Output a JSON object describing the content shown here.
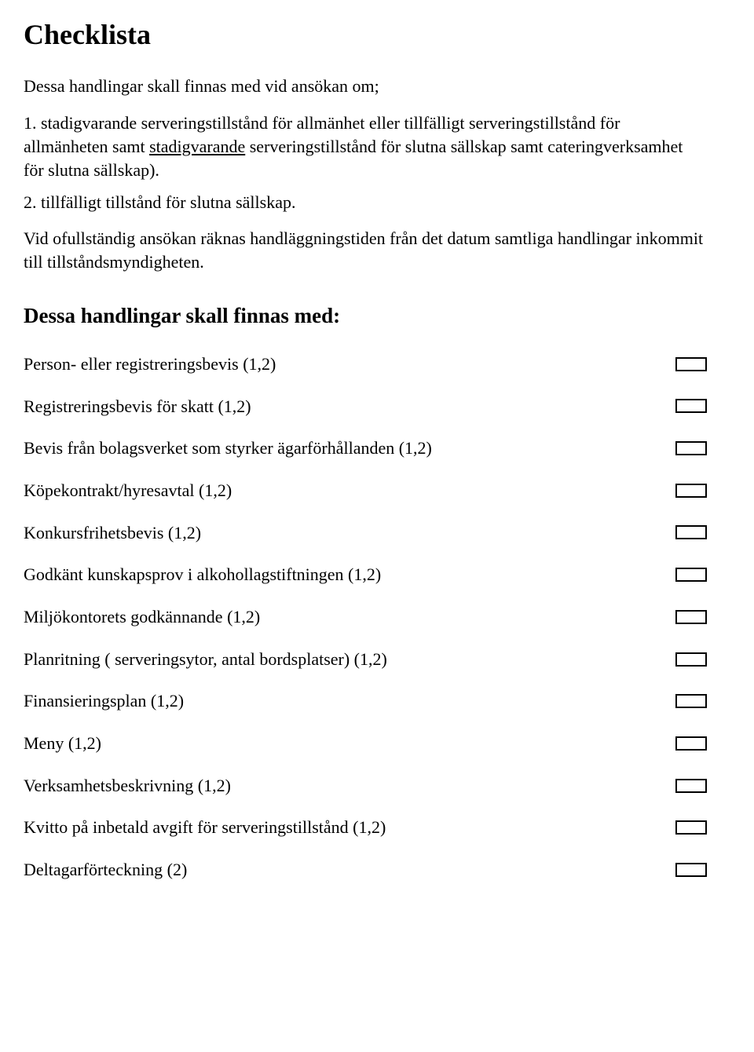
{
  "title": "Checklista",
  "intro": "Dessa handlingar skall finnas med vid ansökan om;",
  "item1_pre": "1. stadigvarande serveringstillstånd för allmänhet eller tillfälligt serveringstillstånd för allmänheten samt ",
  "item1_underline": "stadigvarande",
  "item1_post": " serveringstillstånd för slutna sällskap samt cateringverksamhet för slutna sällskap).",
  "item2": "2. tillfälligt tillstånd för slutna sällskap.",
  "note": "Vid ofullständig ansökan räknas handläggningstiden från det datum samtliga handlingar inkommit till tillståndsmyndigheten.",
  "subtitle": "Dessa handlingar skall finnas med:",
  "checks": [
    {
      "label": "Person- eller registreringsbevis (1,2)"
    },
    {
      "label": "Registreringsbevis för skatt (1,2)"
    },
    {
      "label": "Bevis från bolagsverket som styrker ägarförhållanden (1,2)"
    },
    {
      "label": "Köpekontrakt/hyresavtal (1,2)"
    },
    {
      "label": "Konkursfrihetsbevis (1,2)"
    },
    {
      "label": "Godkänt kunskapsprov i alkohollagstiftningen (1,2)"
    },
    {
      "label": "Miljökontorets godkännande (1,2)"
    },
    {
      "label": "Planritning ( serveringsytor, antal bordsplatser) (1,2)"
    },
    {
      "label": "Finansieringsplan (1,2)"
    },
    {
      "label": "Meny (1,2)"
    },
    {
      "label": "Verksamhetsbeskrivning (1,2)"
    },
    {
      "label": "Kvitto på inbetald avgift för serveringstillstånd (1,2)"
    },
    {
      "label": "Deltagarförteckning (2)"
    }
  ]
}
